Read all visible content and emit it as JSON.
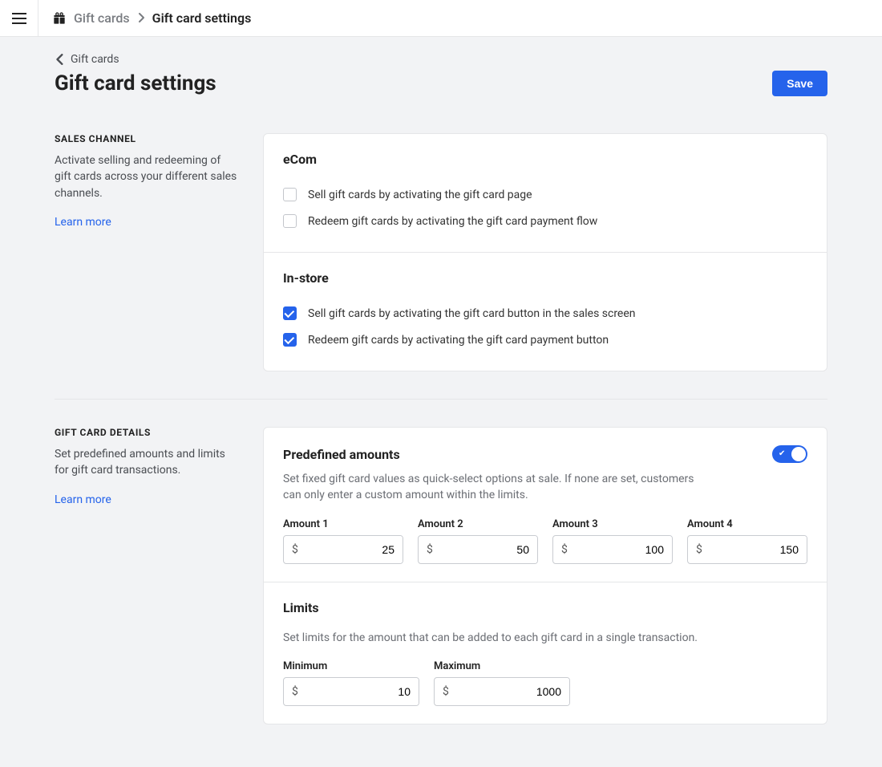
{
  "header": {
    "breadcrumb_parent": "Gift cards",
    "breadcrumb_current": "Gift card settings"
  },
  "back": {
    "label": "Gift cards"
  },
  "title": "Gift card settings",
  "save": "Save",
  "sales_channel": {
    "heading": "SALES CHANNEL",
    "desc": "Activate selling and redeeming of gift cards across your different sales channels.",
    "learn": "Learn more",
    "ecom": {
      "title": "eCom",
      "sell": {
        "label": "Sell gift cards by activating the gift card page",
        "checked": false
      },
      "redeem": {
        "label": "Redeem gift cards by activating the gift card payment flow",
        "checked": false
      }
    },
    "instore": {
      "title": "In-store",
      "sell": {
        "label": "Sell gift cards by activating the gift card button in the sales screen",
        "checked": true
      },
      "redeem": {
        "label": "Redeem gift cards by activating the gift card payment button",
        "checked": true
      }
    }
  },
  "details": {
    "heading": "GIFT CARD DETAILS",
    "desc": "Set predefined amounts and limits for gift card transactions.",
    "learn": "Learn more",
    "predefined": {
      "title": "Predefined amounts",
      "toggle_on": true,
      "desc": "Set fixed gift card values as quick-select options at sale. If none are set, customers can only enter a custom amount within the limits.",
      "amounts": [
        {
          "label": "Amount 1",
          "value": "25"
        },
        {
          "label": "Amount 2",
          "value": "50"
        },
        {
          "label": "Amount 3",
          "value": "100"
        },
        {
          "label": "Amount 4",
          "value": "150"
        }
      ]
    },
    "limits": {
      "title": "Limits",
      "desc": "Set limits for the amount that can be added to each gift card in a single transaction.",
      "min": {
        "label": "Minimum",
        "value": "10"
      },
      "max": {
        "label": "Maximum",
        "value": "1000"
      }
    }
  },
  "currency_symbol": "$"
}
